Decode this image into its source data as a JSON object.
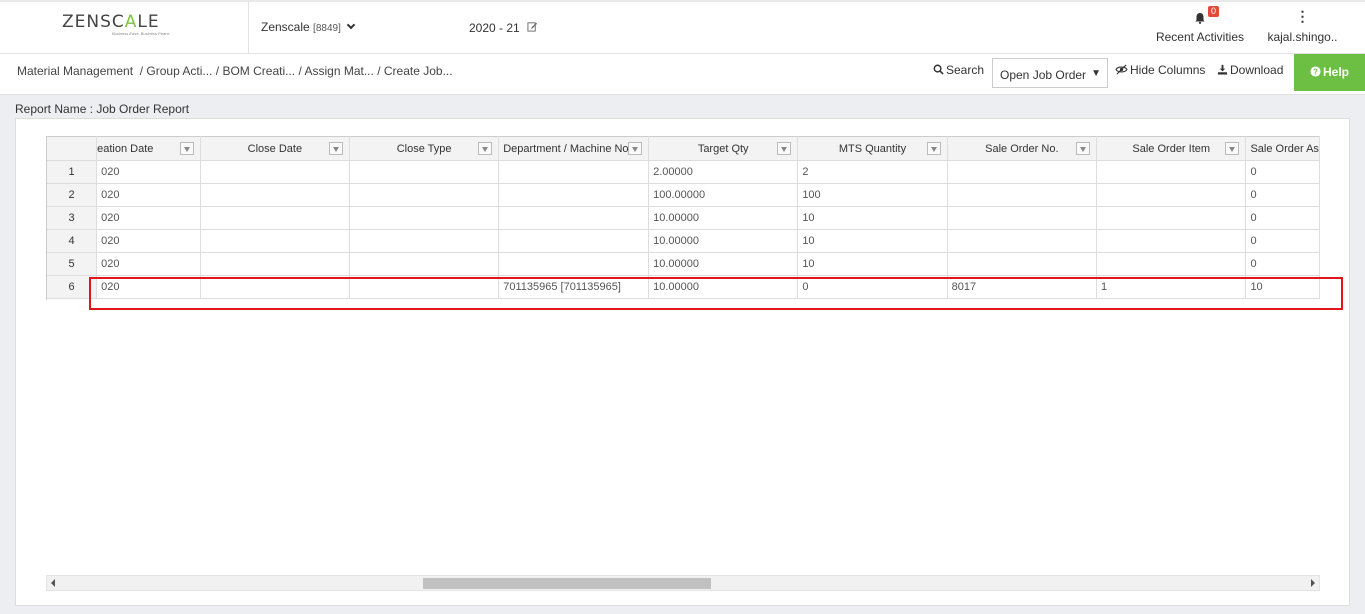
{
  "header": {
    "logo_prefix": "ZENSC",
    "logo_mid": "A",
    "logo_suffix": "LE",
    "logo_tagline": "Business Ease. Business Peace.",
    "company_name": "Zenscale",
    "company_code": "[8849]",
    "fiscal_year": "2020 - 21",
    "notification_count": "0",
    "recent_activities_label": "Recent Activities",
    "user_name": "kajal.shingo.."
  },
  "breadcrumb": {
    "items": [
      "Material Management",
      "/ Group Acti...",
      "/ BOM Creati...",
      "/ Assign Mat...",
      "/ Create Job..."
    ]
  },
  "toolbar": {
    "search_label": "Search",
    "filter_select_value": "Open Job Order",
    "hide_columns_label": "Hide Columns",
    "download_label": "Download",
    "help_label": "Help"
  },
  "report": {
    "name_label": "Report Name : Job Order Report",
    "columns": [
      "eation Date",
      "Close Date",
      "Close Type",
      "Department / Machine No.",
      "Target Qty",
      "MTS Quantity",
      "Sale Order No.",
      "Sale Order Item",
      "Sale Order As"
    ],
    "rows": [
      {
        "num": "1",
        "cells": [
          "020",
          "",
          "",
          "",
          "2.00000",
          "2",
          "",
          "",
          "0"
        ]
      },
      {
        "num": "2",
        "cells": [
          "020",
          "",
          "",
          "",
          "100.00000",
          "100",
          "",
          "",
          "0"
        ]
      },
      {
        "num": "3",
        "cells": [
          "020",
          "",
          "",
          "",
          "10.00000",
          "10",
          "",
          "",
          "0"
        ]
      },
      {
        "num": "4",
        "cells": [
          "020",
          "",
          "",
          "",
          "10.00000",
          "10",
          "",
          "",
          "0"
        ]
      },
      {
        "num": "5",
        "cells": [
          "020",
          "",
          "",
          "",
          "10.00000",
          "10",
          "",
          "",
          "0"
        ]
      },
      {
        "num": "6",
        "cells": [
          "020",
          "",
          "",
          "701135965 [701135965]",
          "10.00000",
          "0",
          "8017",
          "1",
          "10"
        ]
      }
    ]
  },
  "colors": {
    "help_bg": "#6cbf43",
    "highlight_border": "#e0161b",
    "badge_bg": "#e24b3b"
  }
}
